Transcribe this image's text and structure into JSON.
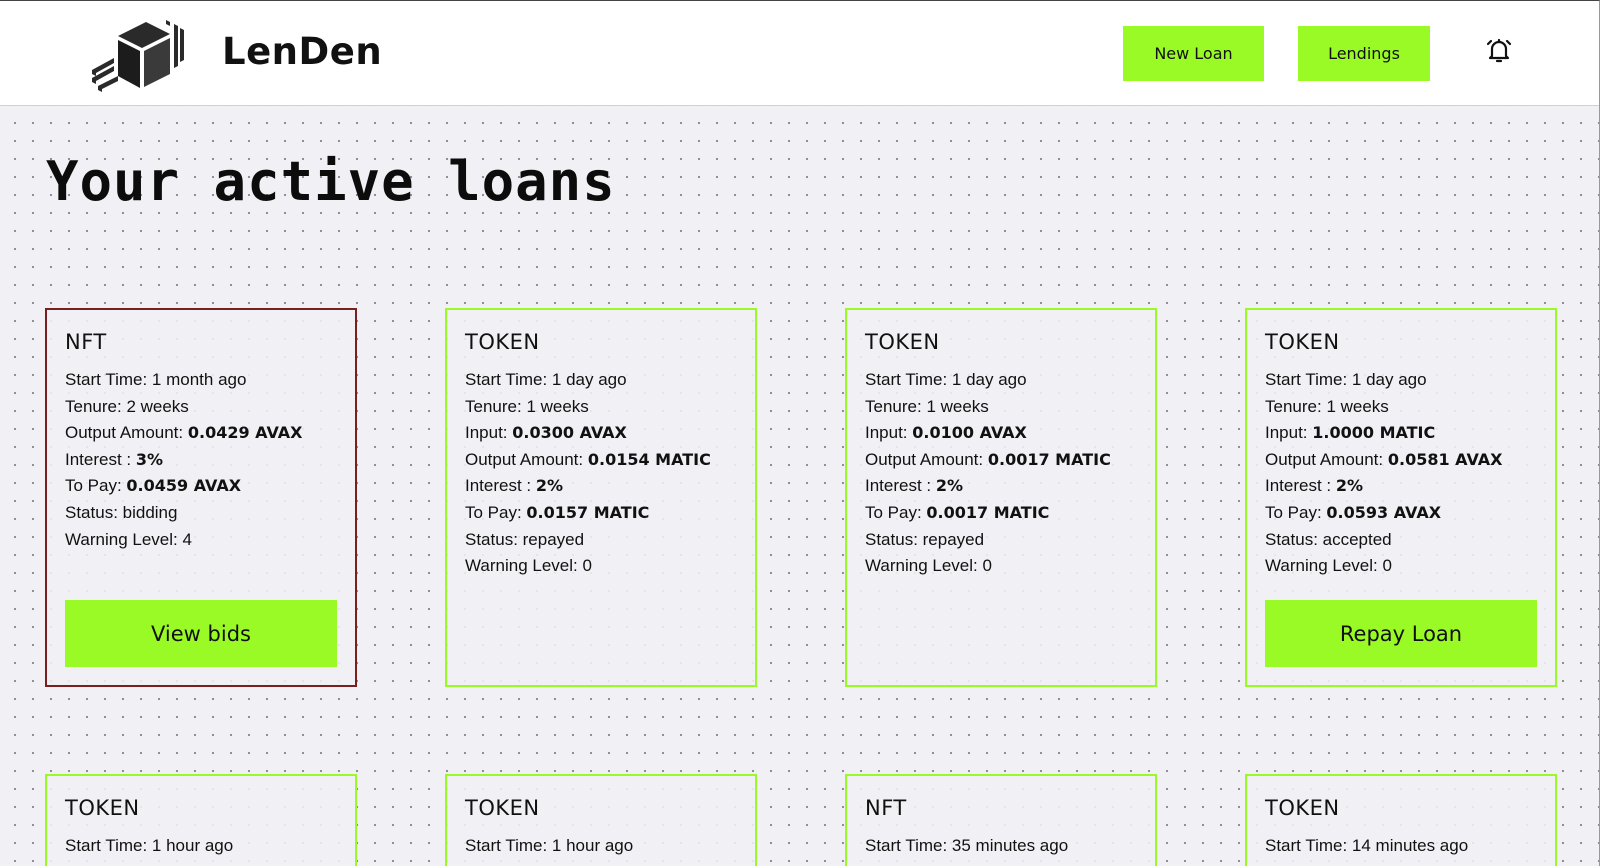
{
  "header": {
    "brand": "LenDen",
    "buttons": {
      "new_loan": "New Loan",
      "lendings": "Lendings"
    },
    "icons": {
      "logo": "cube-logo-icon",
      "notifications": "bell-icon"
    }
  },
  "page_title": "Your active loans",
  "colors": {
    "accent": "#9afa26",
    "warning_border": "#7a1f1f",
    "background": "#f0f0f5"
  },
  "loans": [
    {
      "type": "NFT",
      "rows": [
        {
          "label": "Start Time: ",
          "value": "1 month ago",
          "bold": false
        },
        {
          "label": "Tenure: ",
          "value": "2 weeks",
          "bold": false
        },
        {
          "label": "Output Amount: ",
          "value": "0.0429 AVAX",
          "bold": true
        },
        {
          "label": "Interest : ",
          "value": "3%",
          "bold": true
        },
        {
          "label": "To Pay: ",
          "value": "0.0459 AVAX",
          "bold": true
        },
        {
          "label": "Status: ",
          "value": "bidding",
          "bold": false
        },
        {
          "label": "Warning Level: ",
          "value": "4",
          "bold": false
        }
      ],
      "action": "View bids"
    },
    {
      "type": "TOKEN",
      "rows": [
        {
          "label": "Start Time: ",
          "value": "1 day ago",
          "bold": false
        },
        {
          "label": "Tenure: ",
          "value": "1 weeks",
          "bold": false
        },
        {
          "label": "Input: ",
          "value": "0.0300 AVAX",
          "bold": true
        },
        {
          "label": "Output Amount: ",
          "value": "0.0154 MATIC",
          "bold": true
        },
        {
          "label": "Interest : ",
          "value": "2%",
          "bold": true
        },
        {
          "label": "To Pay: ",
          "value": "0.0157 MATIC",
          "bold": true
        },
        {
          "label": "Status: ",
          "value": "repayed",
          "bold": false
        },
        {
          "label": "Warning Level: ",
          "value": "0",
          "bold": false
        }
      ]
    },
    {
      "type": "TOKEN",
      "rows": [
        {
          "label": "Start Time: ",
          "value": "1 day ago",
          "bold": false
        },
        {
          "label": "Tenure: ",
          "value": "1 weeks",
          "bold": false
        },
        {
          "label": "Input: ",
          "value": "0.0100 AVAX",
          "bold": true
        },
        {
          "label": "Output Amount: ",
          "value": "0.0017 MATIC",
          "bold": true
        },
        {
          "label": "Interest : ",
          "value": "2%",
          "bold": true
        },
        {
          "label": "To Pay: ",
          "value": "0.0017 MATIC",
          "bold": true
        },
        {
          "label": "Status: ",
          "value": "repayed",
          "bold": false
        },
        {
          "label": "Warning Level: ",
          "value": "0",
          "bold": false
        }
      ]
    },
    {
      "type": "TOKEN",
      "rows": [
        {
          "label": "Start Time: ",
          "value": "1 day ago",
          "bold": false
        },
        {
          "label": "Tenure: ",
          "value": "1 weeks",
          "bold": false
        },
        {
          "label": "Input: ",
          "value": "1.0000 MATIC",
          "bold": true
        },
        {
          "label": "Output Amount: ",
          "value": "0.0581 AVAX",
          "bold": true
        },
        {
          "label": "Interest : ",
          "value": "2%",
          "bold": true
        },
        {
          "label": "To Pay: ",
          "value": "0.0593 AVAX",
          "bold": true
        },
        {
          "label": "Status: ",
          "value": "accepted",
          "bold": false
        },
        {
          "label": "Warning Level: ",
          "value": "0",
          "bold": false
        }
      ],
      "action": "Repay Loan"
    },
    {
      "type": "TOKEN",
      "rows": [
        {
          "label": "Start Time: ",
          "value": "1 hour ago",
          "bold": false
        }
      ]
    },
    {
      "type": "TOKEN",
      "rows": [
        {
          "label": "Start Time: ",
          "value": "1 hour ago",
          "bold": false
        }
      ]
    },
    {
      "type": "NFT",
      "rows": [
        {
          "label": "Start Time: ",
          "value": "35 minutes ago",
          "bold": false
        }
      ]
    },
    {
      "type": "TOKEN",
      "rows": [
        {
          "label": "Start Time: ",
          "value": "14 minutes ago",
          "bold": false
        }
      ]
    }
  ]
}
